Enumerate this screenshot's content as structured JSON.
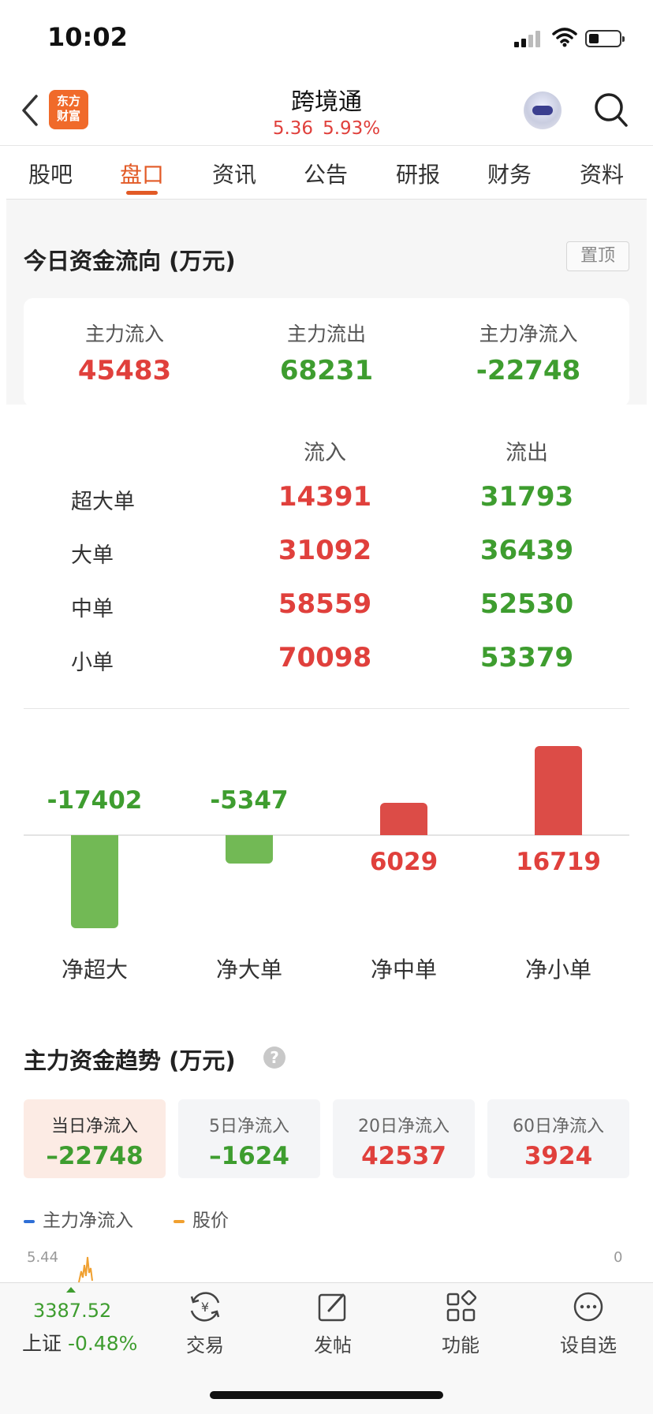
{
  "status_bar": {
    "time": "10:02"
  },
  "header": {
    "logo_text_line1": "东方",
    "logo_text_line2": "财富",
    "title": "跨境通",
    "price": "5.36",
    "change_pct": "5.93%"
  },
  "tabs": [
    {
      "label": "股吧"
    },
    {
      "label": "盘口"
    },
    {
      "label": "资讯"
    },
    {
      "label": "公告"
    },
    {
      "label": "研报"
    },
    {
      "label": "财务"
    },
    {
      "label": "资料"
    }
  ],
  "active_tab": "盘口",
  "fund_flow": {
    "title": "今日资金流向 (万元)",
    "pin_label": "置顶",
    "summary": [
      {
        "label": "主力流入",
        "value": "45483"
      },
      {
        "label": "主力流出",
        "value": "68231"
      },
      {
        "label": "主力净流入",
        "value": "-22748"
      }
    ],
    "table": {
      "headers": [
        "流入",
        "流出"
      ],
      "rows": [
        {
          "label": "超大单",
          "in": "14391",
          "out": "31793"
        },
        {
          "label": "大单",
          "in": "31092",
          "out": "36439"
        },
        {
          "label": "中单",
          "in": "58559",
          "out": "52530"
        },
        {
          "label": "小单",
          "in": "70098",
          "out": "53379"
        }
      ]
    }
  },
  "chart_data": {
    "type": "bar",
    "categories": [
      "净超大",
      "净大单",
      "净中单",
      "净小单"
    ],
    "values": [
      -17402,
      -5347,
      6029,
      16719
    ],
    "labels": [
      "-17402",
      "-5347",
      "6029",
      "16719"
    ],
    "colors": {
      "positive": "#dc4c47",
      "negative": "#72b955"
    }
  },
  "trend": {
    "title": "主力资金趋势 (万元)",
    "help_icon": "?",
    "periods": [
      {
        "label": "当日净流入",
        "value": "–22748",
        "active": true
      },
      {
        "label": "5日净流入",
        "value": "–1624",
        "active": false
      },
      {
        "label": "20日净流入",
        "value": "42537",
        "active": false
      },
      {
        "label": "60日净流入",
        "value": "3924",
        "active": false
      }
    ],
    "legend": [
      {
        "label": "主力净流入",
        "color": "#2f6fd6"
      },
      {
        "label": "股价",
        "color": "#f0a030"
      }
    ],
    "y_left_top": "5.44",
    "y_right_top": "0"
  },
  "bottom_bar": {
    "index_value": "3387.52",
    "index_name": "上证",
    "index_change": "-0.48%",
    "nav": [
      {
        "label": "交易",
        "icon": "trade-icon"
      },
      {
        "label": "发帖",
        "icon": "post-icon"
      },
      {
        "label": "功能",
        "icon": "apps-icon"
      },
      {
        "label": "设自选",
        "icon": "more-icon"
      }
    ]
  },
  "colors": {
    "up": "#e0403c",
    "down": "#3e9d2f",
    "accent": "#e25a26"
  }
}
